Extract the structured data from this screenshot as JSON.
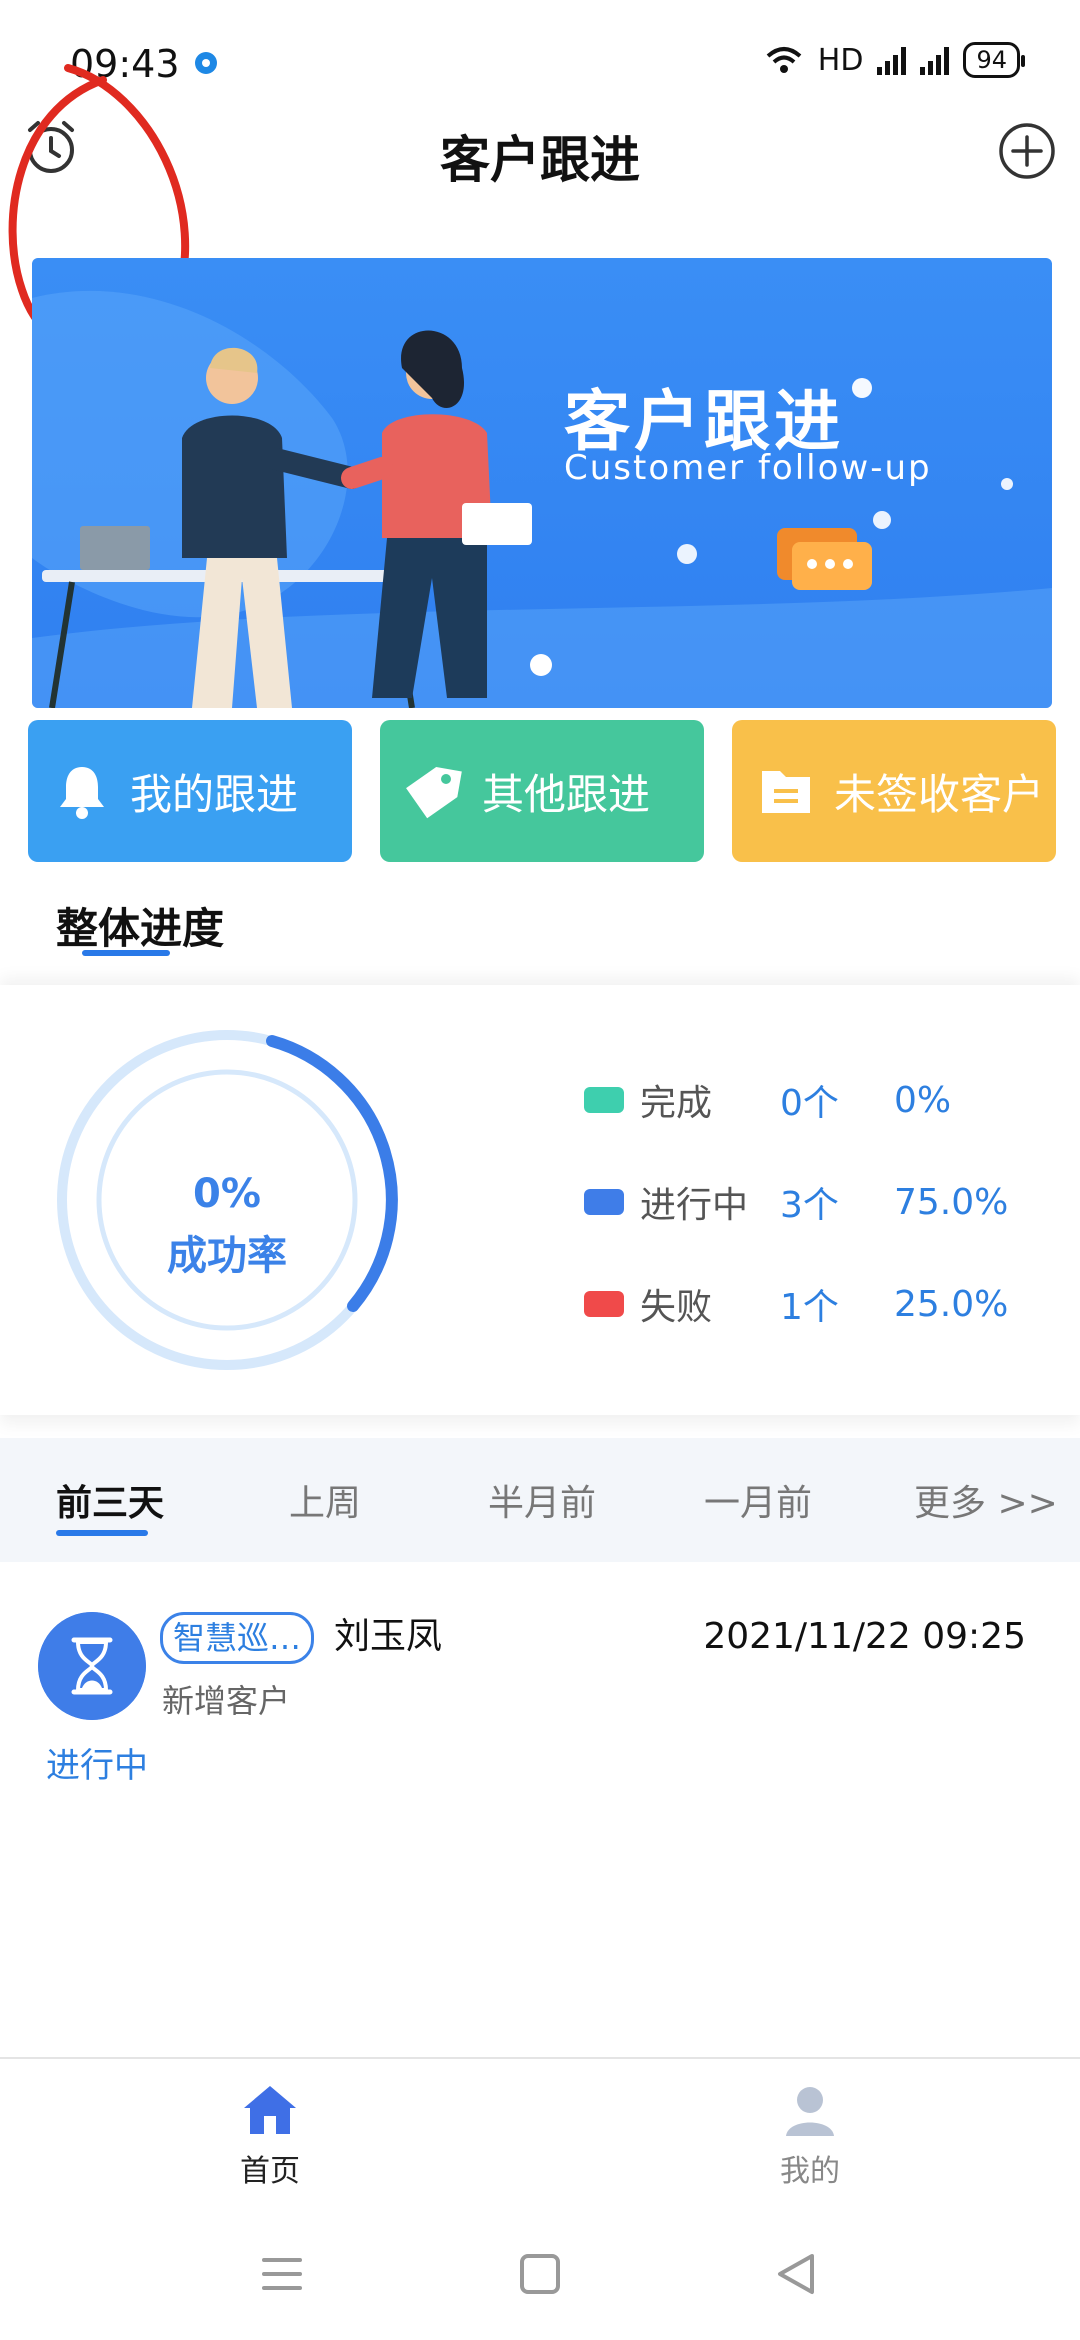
{
  "status_bar": {
    "time": "09:43",
    "network": "HD",
    "battery": "94"
  },
  "header": {
    "title": "客户跟进"
  },
  "banner": {
    "title": "客户跟进",
    "subtitle": "Customer follow-up"
  },
  "quick_actions": [
    {
      "label": "我的跟进",
      "icon": "bell-icon",
      "color": "#3aa0f2"
    },
    {
      "label": "其他跟进",
      "icon": "tag-icon",
      "color": "#45c79c"
    },
    {
      "label": "未签收客户",
      "icon": "folder-icon",
      "color": "#f9c04a"
    }
  ],
  "overall": {
    "section_title": "整体进度",
    "success_rate": "0%",
    "success_label": "成功率",
    "legend": [
      {
        "label": "完成",
        "count": "0个",
        "percent": "0%",
        "color": "#3ecfae"
      },
      {
        "label": "进行中",
        "count": "3个",
        "percent": "75.0%",
        "color": "#3f7de8"
      },
      {
        "label": "失败",
        "count": "1个",
        "percent": "25.0%",
        "color": "#f04a4a"
      }
    ]
  },
  "period_tabs": [
    "前三天",
    "上周",
    "半月前",
    "一月前",
    "更多 >>"
  ],
  "active_period": "前三天",
  "records": [
    {
      "tag": "智慧巡…",
      "name": "刘玉凤",
      "time": "2021/11/22 09:25",
      "type": "新增客户",
      "status": "进行中"
    }
  ],
  "bottom_nav": [
    {
      "label": "首页",
      "active": true
    },
    {
      "label": "我的",
      "active": false
    }
  ]
}
